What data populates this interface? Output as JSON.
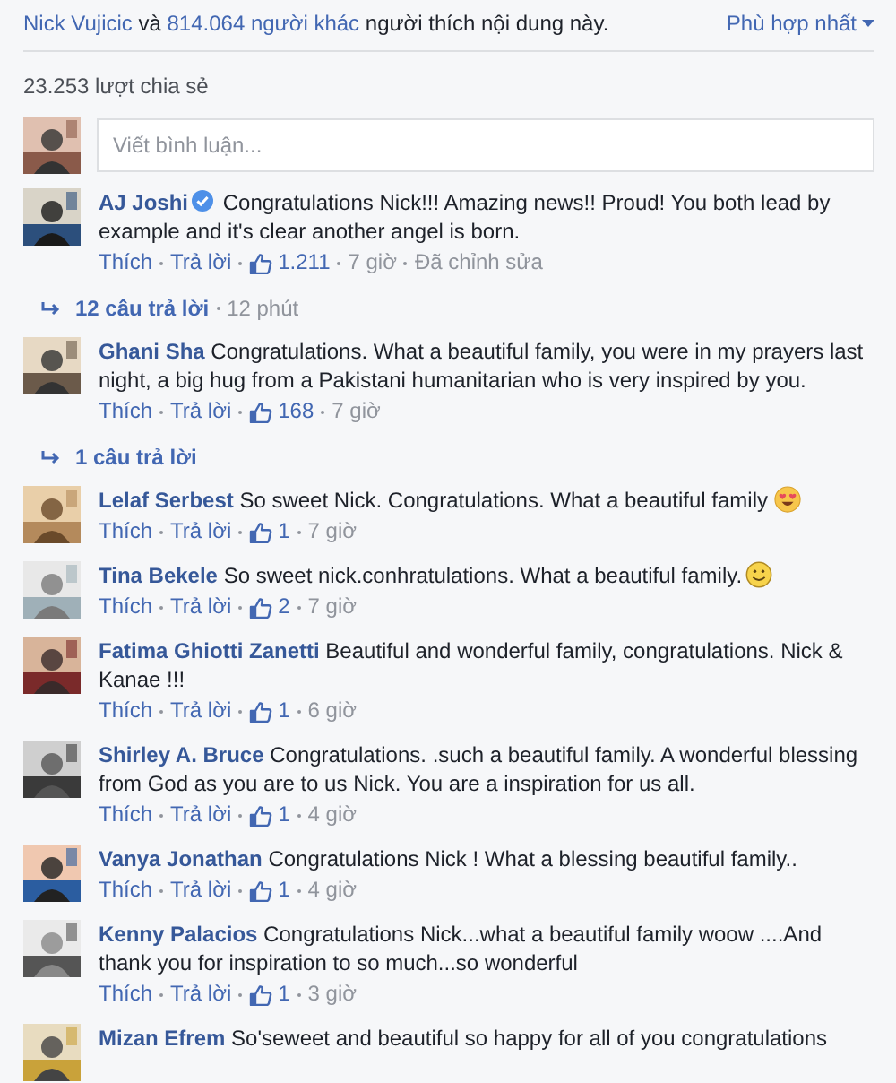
{
  "likes_summary": {
    "names": "Nick Vujicic",
    "joiner": "và",
    "others": "814.064 người khác",
    "suffix": "người thích nội dung này."
  },
  "sort": {
    "label": "Phù hợp nhất"
  },
  "shares": "23.253 lượt chia sẻ",
  "comment_box": {
    "placeholder": "Viết bình luận..."
  },
  "comments": [
    {
      "author": "AJ Joshi",
      "verified": true,
      "text": "Congratulations Nick!!! Amazing news!! Proud! You both lead by example and it's clear another angel is born.",
      "like_label": "Thích",
      "reply_label": "Trả lời",
      "likes": "1.211",
      "time": "7 giờ",
      "edited": "Đã chỉnh sửa",
      "replies": {
        "count": "12 câu trả lời",
        "time": "12 phút"
      }
    },
    {
      "author": "Ghani Sha",
      "verified": false,
      "text": "Congratulations. What a beautiful family, you were in my prayers last night, a big hug from a Pakistani humanitarian who is very inspired by you.",
      "like_label": "Thích",
      "reply_label": "Trả lời",
      "likes": "168",
      "time": "7 giờ",
      "replies": {
        "count": "1 câu trả lời"
      }
    },
    {
      "author": "Lelaf Serbest",
      "verified": false,
      "text": "So sweet Nick. Congratulations. What a beautiful family",
      "kind": "heart-eyes",
      "like_label": "Thích",
      "reply_label": "Trả lời",
      "likes": "1",
      "time": "7 giờ"
    },
    {
      "author": "Tina Bekele",
      "verified": false,
      "text": "So sweet nick.conhratulations. What a beautiful family.",
      "kind": "smile",
      "like_label": "Thích",
      "reply_label": "Trả lời",
      "likes": "2",
      "time": "7 giờ"
    },
    {
      "author": "Fatima Ghiotti Zanetti",
      "verified": false,
      "text": "Beautiful and wonderful family, congratulations. Nick & Kanae !!!",
      "like_label": "Thích",
      "reply_label": "Trả lời",
      "likes": "1",
      "time": "6 giờ"
    },
    {
      "author": "Shirley A. Bruce",
      "verified": false,
      "text": "Congratulations. .such a beautiful family. A wonderful blessing from God as you are to us Nick. You are a inspiration for us all.",
      "like_label": "Thích",
      "reply_label": "Trả lời",
      "likes": "1",
      "time": "4 giờ"
    },
    {
      "author": "Vanya Jonathan",
      "verified": false,
      "text": "Congratulations Nick ! What a blessing beautiful family..",
      "like_label": "Thích",
      "reply_label": "Trả lời",
      "likes": "1",
      "time": "4 giờ"
    },
    {
      "author": "Kenny Palacios",
      "verified": false,
      "text": "Congratulations Nick...what a beautiful family woow ....And thank you for inspiration to so much...so wonderful",
      "like_label": "Thích",
      "reply_label": "Trả lời",
      "likes": "1",
      "time": "3 giờ"
    },
    {
      "author": "Mizan Efrem",
      "verified": false,
      "text": "So'seweet and beautiful so happy for all of you congratulations"
    }
  ]
}
